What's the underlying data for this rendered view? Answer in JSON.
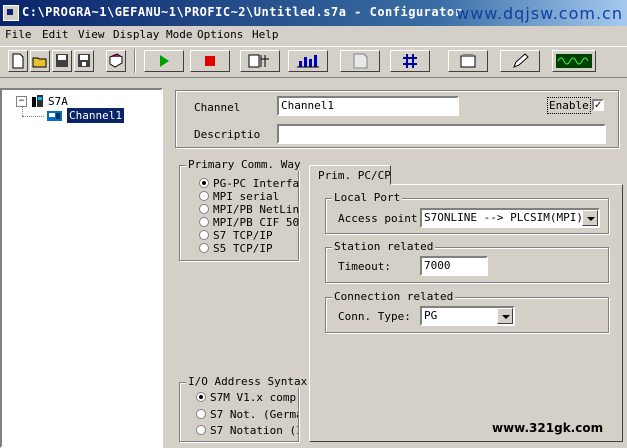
{
  "window": {
    "title": "C:\\PROGRA~1\\GEFANU~1\\PROFIC~2\\Untitled.s7a - Configurator",
    "watermark_top": "www.dqjsw.com.cn",
    "watermark_bottom": "www.321gk.com"
  },
  "menu": [
    "File",
    "Edit",
    "View",
    "Display Mode",
    "Options",
    "Help"
  ],
  "tree": {
    "root": "S7A",
    "child": "Channel1"
  },
  "channel": {
    "label": "Channel",
    "value": "Channel1",
    "enable_label": "Enable",
    "enable_checked": true,
    "description_label": "Descriptio",
    "description_value": ""
  },
  "primary_comm": {
    "title": "Primary Comm. Way",
    "options": [
      "PG-PC Interfac",
      "MPI serial",
      "MPI/PB NetLin",
      "MPI/PB CIF 50",
      "S7 TCP/IP",
      "S5 TCP/IP"
    ],
    "selected": 0
  },
  "io_syntax": {
    "title": "I/O Address Syntax",
    "options": [
      "S7M V1.x comp",
      "S7 Not. (Germa",
      "S7 Notation (I"
    ],
    "selected": 0
  },
  "tab": {
    "label": "Prim. PC/CP"
  },
  "local_port": {
    "title": "Local Port",
    "access_label": "Access point:",
    "access_value": "S7ONLINE --> PLCSIM(MPI)"
  },
  "station": {
    "title": "Station related",
    "timeout_label": "Timeout:",
    "timeout_value": "7000"
  },
  "connection": {
    "title": "Connection related",
    "type_label": "Conn. Type:",
    "type_value": "PG"
  }
}
